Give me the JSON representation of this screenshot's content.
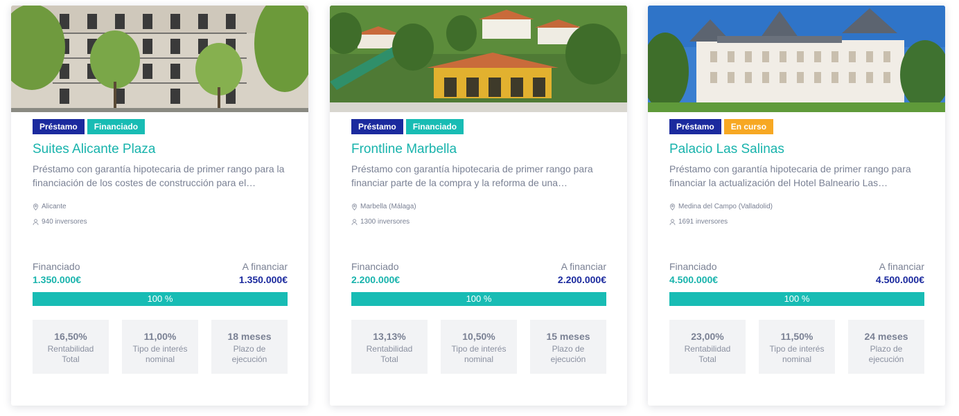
{
  "cards": [
    {
      "badges": [
        "Préstamo",
        "Financiado"
      ],
      "title": "Suites Alicante Plaza",
      "description": "Préstamo con garantía hipotecaria de primer rango para la financiación de los costes de construcción para el…",
      "location": "Alicante",
      "investors": "940 inversores",
      "funded_label": "Financiado",
      "funded_amount": "1.350.000€",
      "target_label": "A financiar",
      "target_amount": "1.350.000€",
      "progress_text": "100 %",
      "progress_value": 100,
      "stats": [
        {
          "value": "16,50%",
          "label": "Rentabilidad Total"
        },
        {
          "value": "11,00%",
          "label": "Tipo de interés nominal"
        },
        {
          "value": "18 meses",
          "label": "Plazo de ejecución"
        }
      ]
    },
    {
      "badges": [
        "Préstamo",
        "Financiado"
      ],
      "title": "Frontline Marbella",
      "description": "Préstamo con garantía hipotecaria de primer rango para financiar parte de la compra y la reforma de una…",
      "location": "Marbella (Málaga)",
      "investors": "1300 inversores",
      "funded_label": "Financiado",
      "funded_amount": "2.200.000€",
      "target_label": "A financiar",
      "target_amount": "2.200.000€",
      "progress_text": "100 %",
      "progress_value": 100,
      "stats": [
        {
          "value": "13,13%",
          "label": "Rentabilidad Total"
        },
        {
          "value": "10,50%",
          "label": "Tipo de interés nominal"
        },
        {
          "value": "15 meses",
          "label": "Plazo de ejecución"
        }
      ]
    },
    {
      "badges": [
        "Préstamo",
        "En curso"
      ],
      "title": "Palacio Las Salinas",
      "description": "Préstamo con garantía hipotecaria de primer rango para financiar la actualización del Hotel Balneario Las…",
      "location": "Medina del Campo (Valladolid)",
      "investors": "1691 inversores",
      "funded_label": "Financiado",
      "funded_amount": "4.500.000€",
      "target_label": "A financiar",
      "target_amount": "4.500.000€",
      "progress_text": "100 %",
      "progress_value": 100,
      "stats": [
        {
          "value": "23,00%",
          "label": "Rentabilidad Total"
        },
        {
          "value": "11,50%",
          "label": "Tipo de interés nominal"
        },
        {
          "value": "24 meses",
          "label": "Plazo de ejecución"
        }
      ]
    }
  ],
  "colors": {
    "navy": "#1b2a9e",
    "teal": "#18bcb4",
    "orange": "#f7a823",
    "text": "#7a8194"
  },
  "icons": {
    "location": "location-pin-icon",
    "investors": "user-icon"
  }
}
